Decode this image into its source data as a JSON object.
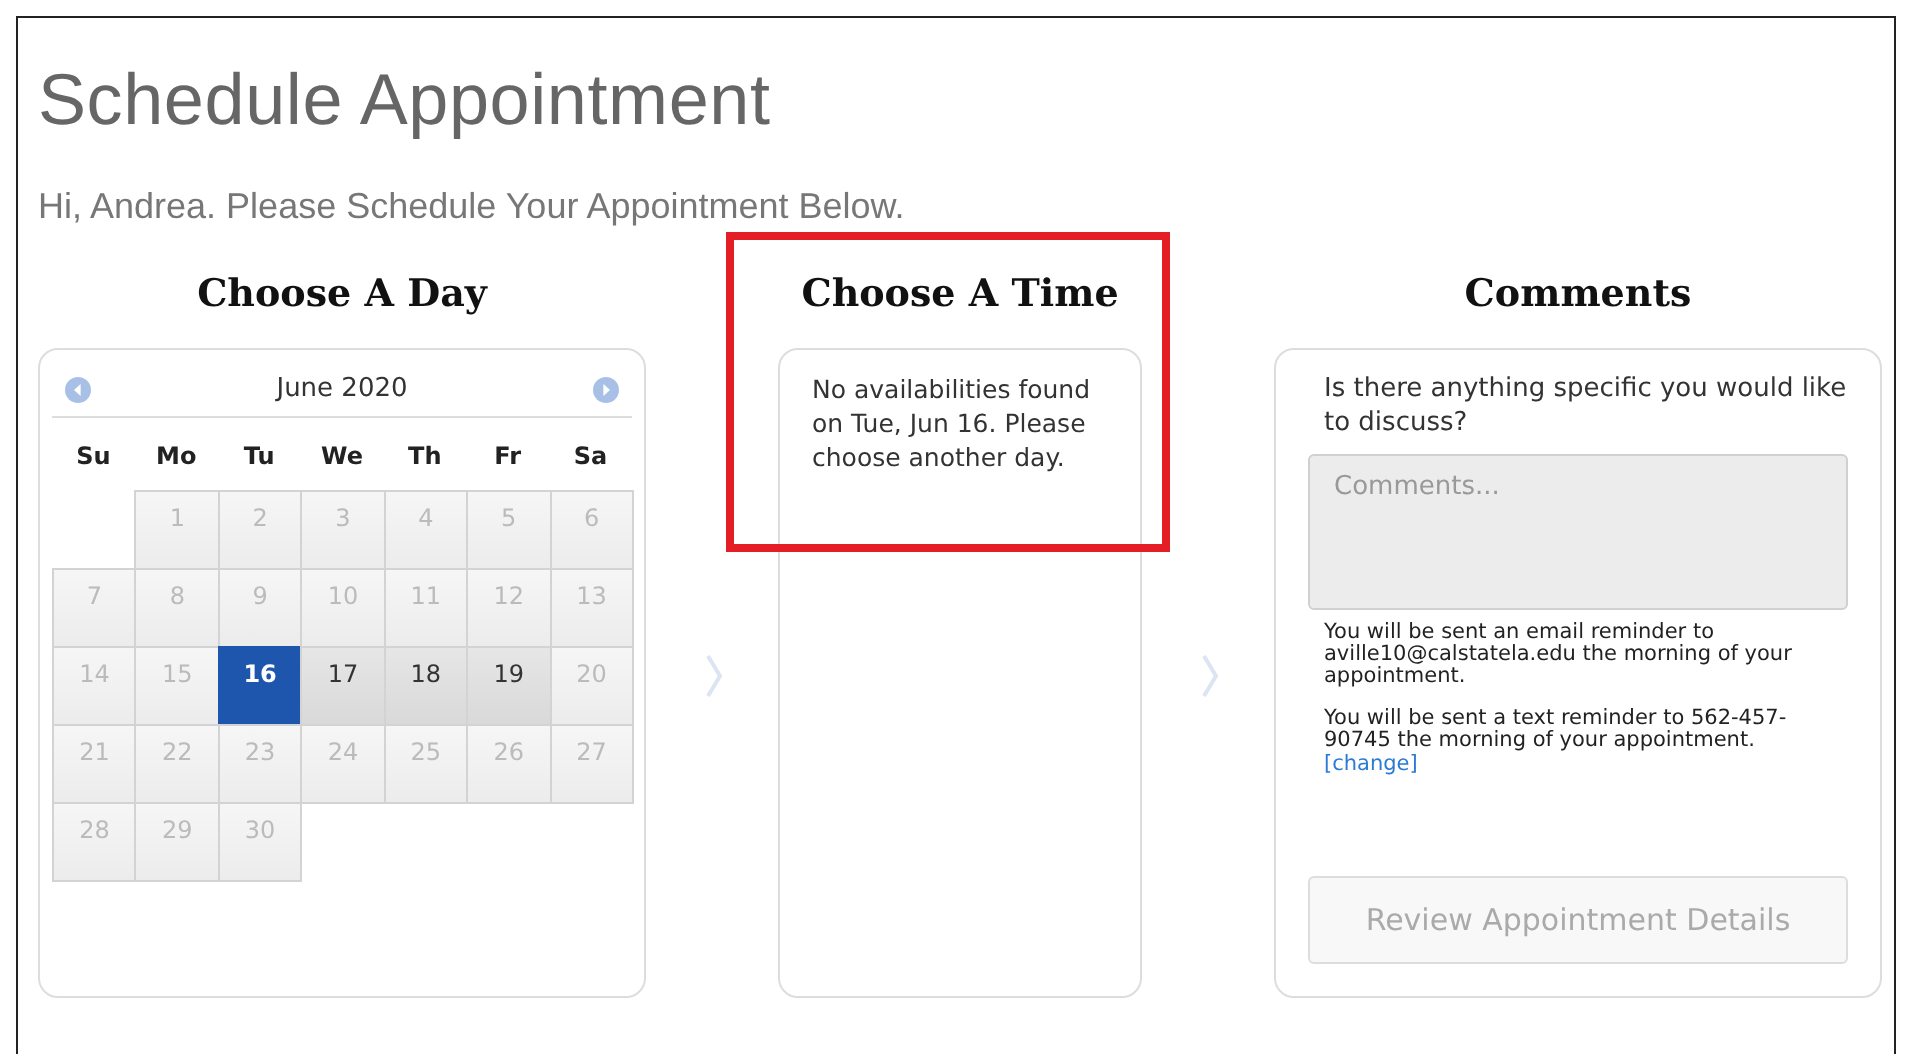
{
  "title": "Schedule Appointment",
  "greeting": "Hi, Andrea. Please Schedule Your Appointment Below.",
  "day_column": {
    "heading": "Choose A Day",
    "month": "June 2020",
    "weekdays": [
      "Su",
      "Mo",
      "Tu",
      "We",
      "Th",
      "Fr",
      "Sa"
    ],
    "days": [
      {
        "label": "1",
        "available": false,
        "selected": false
      },
      {
        "label": "2",
        "available": false,
        "selected": false
      },
      {
        "label": "3",
        "available": false,
        "selected": false
      },
      {
        "label": "4",
        "available": false,
        "selected": false
      },
      {
        "label": "5",
        "available": false,
        "selected": false
      },
      {
        "label": "6",
        "available": false,
        "selected": false
      },
      {
        "label": "7",
        "available": false,
        "selected": false
      },
      {
        "label": "8",
        "available": false,
        "selected": false
      },
      {
        "label": "9",
        "available": false,
        "selected": false
      },
      {
        "label": "10",
        "available": false,
        "selected": false
      },
      {
        "label": "11",
        "available": false,
        "selected": false
      },
      {
        "label": "12",
        "available": false,
        "selected": false
      },
      {
        "label": "13",
        "available": false,
        "selected": false
      },
      {
        "label": "14",
        "available": false,
        "selected": false
      },
      {
        "label": "15",
        "available": false,
        "selected": false
      },
      {
        "label": "16",
        "available": true,
        "selected": true
      },
      {
        "label": "17",
        "available": true,
        "selected": false
      },
      {
        "label": "18",
        "available": true,
        "selected": false
      },
      {
        "label": "19",
        "available": true,
        "selected": false
      },
      {
        "label": "20",
        "available": false,
        "selected": false
      },
      {
        "label": "21",
        "available": false,
        "selected": false
      },
      {
        "label": "22",
        "available": false,
        "selected": false
      },
      {
        "label": "23",
        "available": false,
        "selected": false
      },
      {
        "label": "24",
        "available": false,
        "selected": false
      },
      {
        "label": "25",
        "available": false,
        "selected": false
      },
      {
        "label": "26",
        "available": false,
        "selected": false
      },
      {
        "label": "27",
        "available": false,
        "selected": false
      },
      {
        "label": "28",
        "available": false,
        "selected": false
      },
      {
        "label": "29",
        "available": false,
        "selected": false
      },
      {
        "label": "30",
        "available": false,
        "selected": false
      }
    ]
  },
  "time_column": {
    "heading": "Choose A Time",
    "message": "No availabilities found on Tue, Jun 16. Please choose another day.",
    "highlighted": true
  },
  "comments_column": {
    "heading": "Comments",
    "question": "Is there anything specific you would like to discuss?",
    "placeholder": "Comments...",
    "email_note": "You will be sent an email reminder to aville10@calstatela.edu the morning of your appointment.",
    "text_note": "You will be sent a text reminder to 562-457-90745 the morning of your appointment.",
    "change_link": "[change]",
    "button": {
      "label": "Review Appointment Details",
      "disabled": true
    }
  }
}
